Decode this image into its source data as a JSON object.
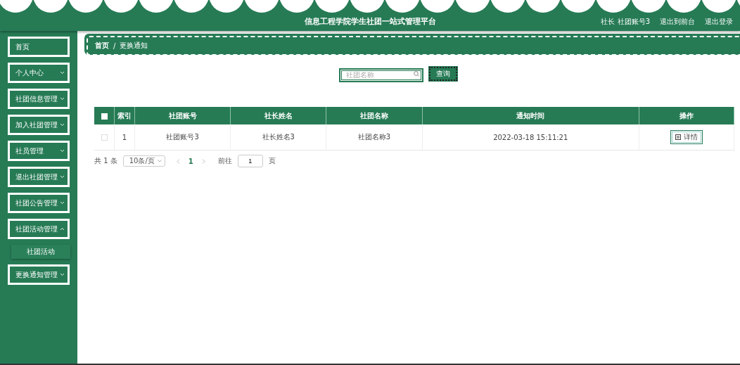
{
  "header": {
    "title": "信息工程学院学生社团一站式管理平台",
    "user": "社长 社团账号3",
    "links": [
      "退出到前台",
      "退出登录"
    ]
  },
  "sidebar": {
    "items": [
      {
        "label": "首页",
        "kind": "link"
      },
      {
        "label": "个人中心",
        "kind": "menu",
        "expanded": false
      },
      {
        "label": "社团信息管理",
        "kind": "menu",
        "expanded": false
      },
      {
        "label": "加入社团管理",
        "kind": "menu",
        "expanded": false
      },
      {
        "label": "社员管理",
        "kind": "menu",
        "expanded": false
      },
      {
        "label": "退出社团管理",
        "kind": "menu",
        "expanded": false
      },
      {
        "label": "社团公告管理",
        "kind": "menu",
        "expanded": false
      },
      {
        "label": "社团活动管理",
        "kind": "menu",
        "expanded": true,
        "children": [
          {
            "label": "社团活动"
          }
        ]
      },
      {
        "label": "更换通知管理",
        "kind": "menu",
        "expanded": false
      }
    ]
  },
  "breadcrumb": {
    "items": [
      "首页",
      "更换通知"
    ],
    "separator": "/"
  },
  "search": {
    "placeholder": "社团名称",
    "button": "查询"
  },
  "table": {
    "select_all_checked": false,
    "columns": [
      "索引",
      "社团账号",
      "社长姓名",
      "社团名称",
      "通知时间",
      "操作"
    ],
    "rows": [
      {
        "checked": false,
        "cells": [
          "1",
          "社团账号3",
          "社长姓名3",
          "社团名称3",
          "2022-03-18 15:11:21"
        ],
        "action": "详情"
      }
    ]
  },
  "pagination": {
    "total": "共 1 条",
    "page_size": "10条/页",
    "pages": [
      {
        "label": "1",
        "selected": true
      }
    ],
    "goto_label": "前往",
    "goto_value": "1",
    "goto_suffix": "页"
  }
}
